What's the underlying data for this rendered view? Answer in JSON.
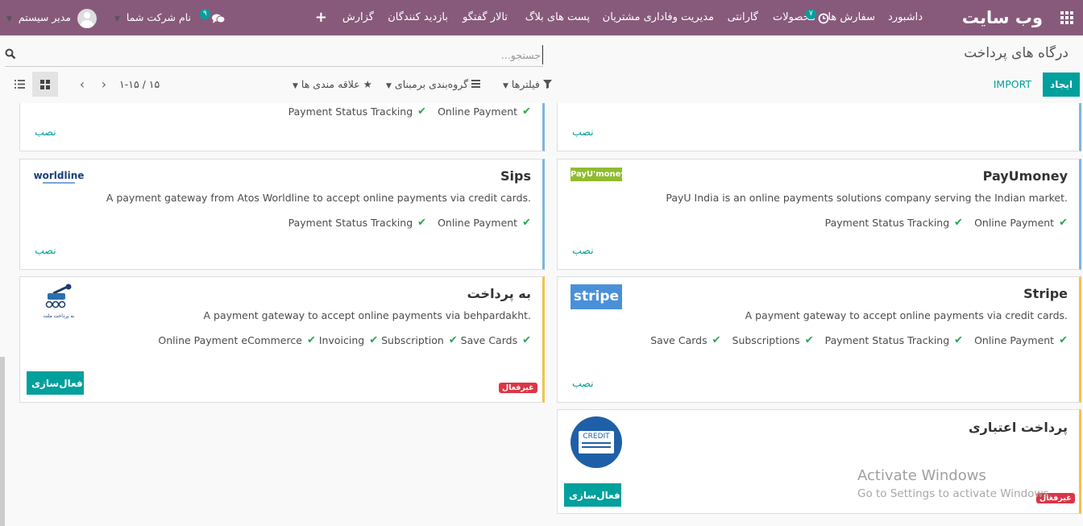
{
  "navbar": {
    "brand": "وب سایت",
    "menu": [
      "داشبورد",
      "سفارش ها",
      "محصولات",
      "گارانتی",
      "مدیریت وفاداری مشتریان",
      "پست های بلاگ",
      "تالار گفتگو",
      "بازدید کنندگان",
      "گزارش"
    ],
    "activity_count": "۷",
    "messages_count": "۹",
    "company": "نام شرکت شما",
    "user": "مدیر سیستم",
    "accent_color": "#875a7b"
  },
  "control": {
    "title": "درگاه های پرداخت",
    "search_placeholder": "جستجو...",
    "create_label": "ایجاد",
    "import_label": "IMPORT",
    "filters_label": "فیلترها",
    "groupby_label": "گروه‌بندی برمبنای",
    "favorites_label": "علاقه مندی ها",
    "pager": "۱-۱۵ / ۱۵"
  },
  "cards": {
    "top_left_install": "نصب",
    "top_left_features": [
      "Online Payment",
      "Payment Status Tracking"
    ],
    "top_right_install": "نصب",
    "payumoney": {
      "title": "PayUmoney",
      "description": "PayU India is an online payments solutions company serving the Indian market.",
      "features": [
        "Online Payment",
        "Payment Status Tracking"
      ],
      "install": "نصب",
      "logo_text_a": "PayU",
      "logo_text_b": "money"
    },
    "sips": {
      "title": "Sips",
      "description": "A payment gateway from Atos Worldline to accept online payments via credit cards.",
      "features": [
        "Online Payment",
        "Payment Status Tracking"
      ],
      "install": "نصب",
      "logo_text": "worldline"
    },
    "stripe": {
      "title": "Stripe",
      "description": "A payment gateway to accept online payments via credit cards.",
      "features": [
        "Online Payment",
        "Payment Status Tracking",
        "Subscriptions",
        "Save Cards"
      ],
      "install": "نصب",
      "logo_text": "stripe"
    },
    "behpardakht": {
      "title": "به پرداخت",
      "description": "A payment gateway to accept online payments via behpardakht.",
      "features": [
        "Save Cards",
        "Subscription",
        "Invoicing",
        "eCommerce",
        "Online Payment"
      ],
      "status": "غیرفعال",
      "activate": "فعال‌سازی",
      "logo_caption": "به پرداخت ملت"
    },
    "credit": {
      "title": "پرداخت اعتباری",
      "status": "غیرفعال",
      "activate": "فعال‌سازی",
      "logo_text": "CREDIT"
    }
  },
  "watermark": {
    "line1": "Activate Windows",
    "line2": "Go to Settings to activate Windows."
  }
}
